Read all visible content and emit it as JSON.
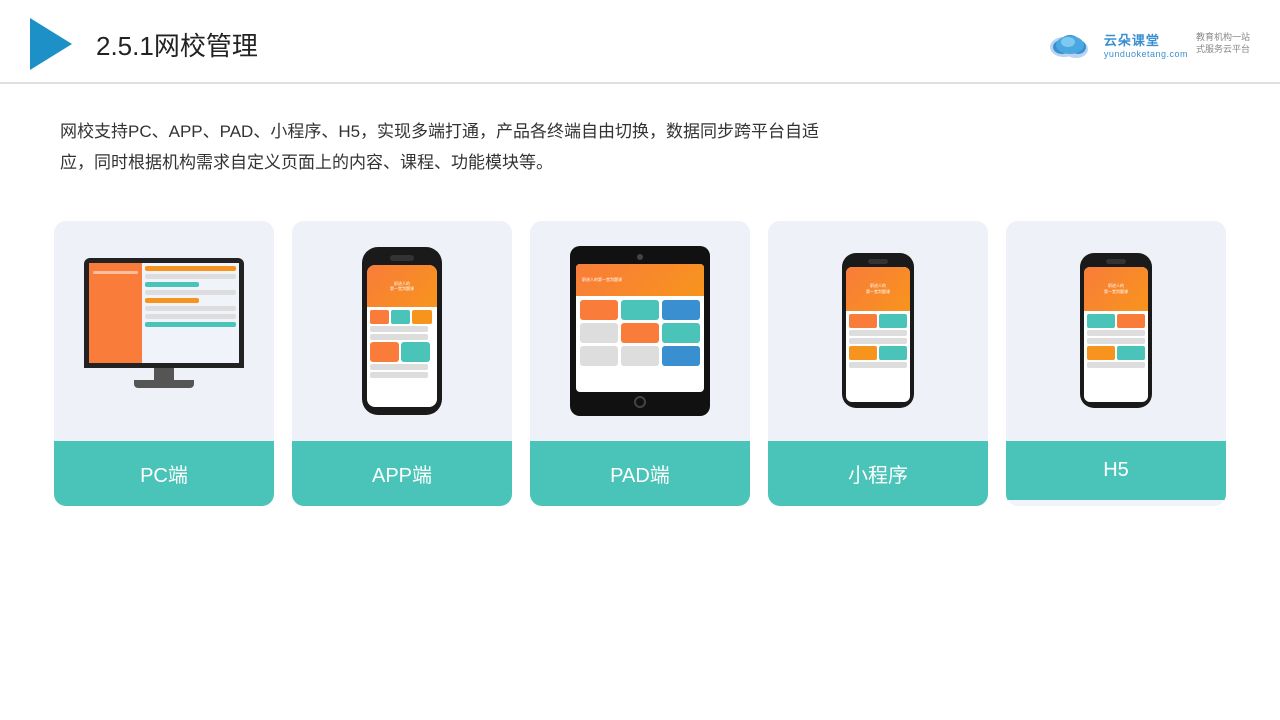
{
  "header": {
    "title_prefix": "2.5.1",
    "title_main": "网校管理",
    "logo_name": "云朵课堂",
    "logo_url": "yunduoketang.com",
    "logo_slogan_line1": "教育机构一站",
    "logo_slogan_line2": "式服务云平台"
  },
  "description": {
    "text": "网校支持PC、APP、PAD、小程序、H5，实现多端打通，产品各终端自由切换，数据同步跨平台自适应，同时根据机构需求自定义页面上的内容、课程、功能模块等。"
  },
  "cards": [
    {
      "id": "pc",
      "label": "PC端"
    },
    {
      "id": "app",
      "label": "APP端"
    },
    {
      "id": "pad",
      "label": "PAD端"
    },
    {
      "id": "miniprogram",
      "label": "小程序"
    },
    {
      "id": "h5",
      "label": "H5"
    }
  ]
}
